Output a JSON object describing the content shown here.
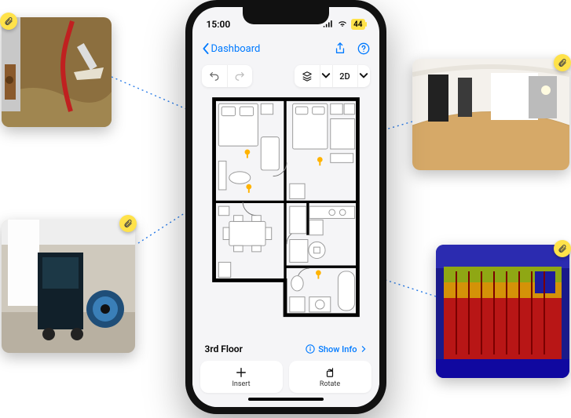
{
  "status": {
    "time": "15:00",
    "battery_percent": "44"
  },
  "nav": {
    "back_label": "Dashboard",
    "share_icon": "share-icon",
    "help_icon": "help-icon"
  },
  "toolbar": {
    "undo_icon": "undo-icon",
    "redo_icon": "redo-icon",
    "layers_icon": "layers-icon",
    "view_mode": "2D"
  },
  "floor": {
    "label": "3rd Floor",
    "show_info_label": "Show Info"
  },
  "actions": {
    "insert_label": "Insert",
    "rotate_label": "Rotate"
  },
  "thumbnails": {
    "top_left": {
      "name": "water-damage-photo"
    },
    "top_right": {
      "name": "360-room-photo"
    },
    "bottom_left": {
      "name": "dehumidifier-photo"
    },
    "bottom_right": {
      "name": "thermal-scan-photo"
    }
  },
  "colors": {
    "accent": "#007aff",
    "clip_badge": "#ffe24a",
    "pin": "#ffb300"
  }
}
